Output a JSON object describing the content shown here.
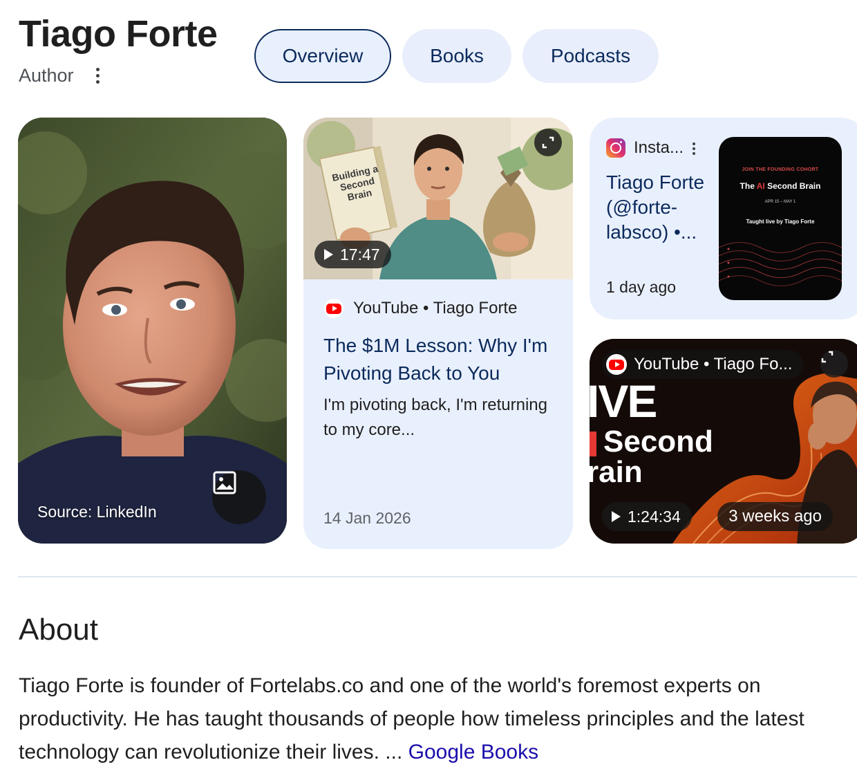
{
  "header": {
    "name": "Tiago Forte",
    "subtitle": "Author"
  },
  "tabs": [
    {
      "label": "Overview",
      "active": true
    },
    {
      "label": "Books",
      "active": false
    },
    {
      "label": "Podcasts",
      "active": false
    }
  ],
  "portrait_card": {
    "source_label": "Source: LinkedIn",
    "icon": "image-icon"
  },
  "youtube_card_1": {
    "thumbnail_book_text": "Building a Second Brain",
    "duration": "17:47",
    "source": "YouTube • Tiago Forte",
    "title": "The $1M Lesson: Why I'm Pivoting Back to You",
    "description": "I'm pivoting back, I'm returning to my core...",
    "date": "14 Jan 2026"
  },
  "instagram_card": {
    "source": "Insta...",
    "title": "Tiago Forte (@forte-labsco) •...",
    "time": "1 day ago",
    "thumbnail": {
      "line1": "JOIN THE FOUNDING COHORT",
      "line2_a": "The ",
      "line2_b": "AI",
      "line2_c": " Second Brain",
      "line3": "APR 15 – MAY 1",
      "line4": "Taught live by Tiago Forte"
    }
  },
  "youtube_card_2": {
    "source": "YouTube • Tiago Fo...",
    "thumb_text_1": "IVE",
    "thumb_text_2": "Second",
    "thumb_text_3": "rain",
    "duration": "1:24:34",
    "age": "3 weeks ago"
  },
  "about": {
    "heading": "About",
    "text": "Tiago Forte is founder of Fortelabs.co and one of the world's foremost experts on productivity. He has taught thousands of people how timeless principles and the latest technology can revolutionize their lives. ... ",
    "link": "Google Books"
  },
  "colors": {
    "card_bg": "#e9f0fd",
    "tab_bg": "#e8eefc",
    "title_blue": "#0b2a5c",
    "link_blue": "#1a0dab",
    "youtube_red": "#ff0000"
  }
}
